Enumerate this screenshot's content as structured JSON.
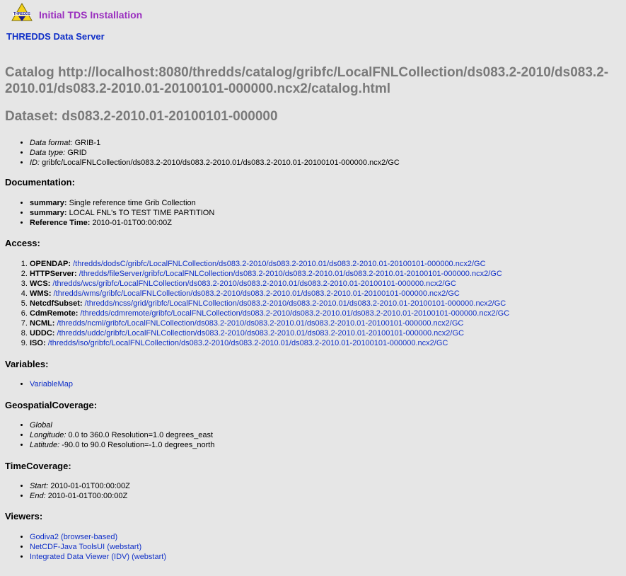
{
  "header": {
    "install_title": "Initial TDS Installation",
    "server_link": "THREDDS Data Server",
    "logo_text": "THREDDS"
  },
  "catalog_title": "Catalog http://localhost:8080/thredds/catalog/gribfc/LocalFNLCollection/ds083.2-2010/ds083.2-2010.01/ds083.2-2010.01-20100101-000000.ncx2/catalog.html",
  "dataset_title": "Dataset: ds083.2-2010.01-20100101-000000",
  "info": [
    {
      "label": "Data format:",
      "value": " GRIB-1"
    },
    {
      "label": "Data type:",
      "value": " GRID"
    },
    {
      "label": "ID:",
      "value": " gribfc/LocalFNLCollection/ds083.2-2010/ds083.2-2010.01/ds083.2-2010.01-20100101-000000.ncx2/GC"
    }
  ],
  "documentation": {
    "heading": "Documentation:",
    "items": [
      {
        "label": "summary:",
        "value": " Single reference time Grib Collection"
      },
      {
        "label": "summary:",
        "value": " LOCAL FNL's TO TEST TIME PARTITION"
      },
      {
        "label": "Reference Time:",
        "value": " 2010-01-01T00:00:00Z"
      }
    ]
  },
  "access": {
    "heading": "Access:",
    "items": [
      {
        "label": "OPENDAP:",
        "link": "/thredds/dodsC/gribfc/LocalFNLCollection/ds083.2-2010/ds083.2-2010.01/ds083.2-2010.01-20100101-000000.ncx2/GC"
      },
      {
        "label": "HTTPServer:",
        "link": "/thredds/fileServer/gribfc/LocalFNLCollection/ds083.2-2010/ds083.2-2010.01/ds083.2-2010.01-20100101-000000.ncx2/GC"
      },
      {
        "label": "WCS:",
        "link": "/thredds/wcs/gribfc/LocalFNLCollection/ds083.2-2010/ds083.2-2010.01/ds083.2-2010.01-20100101-000000.ncx2/GC"
      },
      {
        "label": "WMS:",
        "link": "/thredds/wms/gribfc/LocalFNLCollection/ds083.2-2010/ds083.2-2010.01/ds083.2-2010.01-20100101-000000.ncx2/GC"
      },
      {
        "label": "NetcdfSubset:",
        "link": "/thredds/ncss/grid/gribfc/LocalFNLCollection/ds083.2-2010/ds083.2-2010.01/ds083.2-2010.01-20100101-000000.ncx2/GC"
      },
      {
        "label": "CdmRemote:",
        "link": "/thredds/cdmremote/gribfc/LocalFNLCollection/ds083.2-2010/ds083.2-2010.01/ds083.2-2010.01-20100101-000000.ncx2/GC"
      },
      {
        "label": "NCML:",
        "link": "/thredds/ncml/gribfc/LocalFNLCollection/ds083.2-2010/ds083.2-2010.01/ds083.2-2010.01-20100101-000000.ncx2/GC"
      },
      {
        "label": "UDDC:",
        "link": "/thredds/uddc/gribfc/LocalFNLCollection/ds083.2-2010/ds083.2-2010.01/ds083.2-2010.01-20100101-000000.ncx2/GC"
      },
      {
        "label": "ISO:",
        "link": "/thredds/iso/gribfc/LocalFNLCollection/ds083.2-2010/ds083.2-2010.01/ds083.2-2010.01-20100101-000000.ncx2/GC"
      }
    ]
  },
  "variables": {
    "heading": "Variables:",
    "link": "VariableMap"
  },
  "geo": {
    "heading": "GeospatialCoverage:",
    "global": "Global",
    "items": [
      {
        "label": "Longitude:",
        "value": " 0.0 to 360.0 Resolution=1.0 degrees_east"
      },
      {
        "label": "Latitude:",
        "value": " -90.0 to 90.0 Resolution=-1.0 degrees_north"
      }
    ]
  },
  "time": {
    "heading": "TimeCoverage:",
    "items": [
      {
        "label": "Start:",
        "value": " 2010-01-01T00:00:00Z"
      },
      {
        "label": "End:",
        "value": " 2010-01-01T00:00:00Z"
      }
    ]
  },
  "viewers": {
    "heading": "Viewers:",
    "items": [
      "Godiva2 (browser-based)",
      "NetCDF-Java ToolsUI (webstart)",
      "Integrated Data Viewer (IDV) (webstart)"
    ]
  },
  "colors": {
    "background": "#e6e6e6",
    "title_gray": "#7a7a7a",
    "link_blue": "#1030c8",
    "install_purple": "#9a2fbf"
  }
}
